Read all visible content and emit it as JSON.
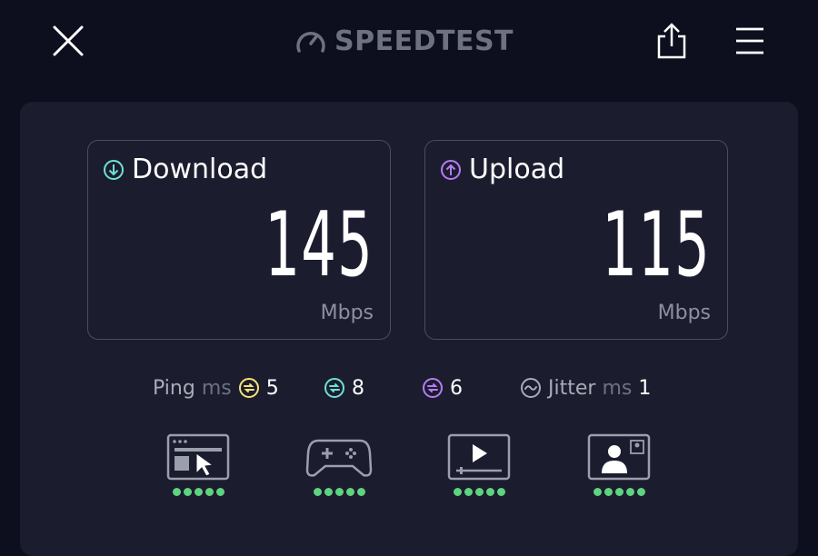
{
  "header": {
    "logo_text": "SPEEDTEST",
    "logo_mark": "®"
  },
  "download": {
    "label": "Download",
    "value": "145",
    "unit": "Mbps"
  },
  "upload": {
    "label": "Upload",
    "value": "115",
    "unit": "Mbps"
  },
  "ping": {
    "label": "Ping",
    "unit": "ms",
    "idle": "5",
    "download": "8",
    "upload": "6"
  },
  "jitter": {
    "label": "Jitter",
    "unit": "ms",
    "value": "1"
  },
  "experience": [
    {
      "icon": "web-browsing-icon",
      "rating": 5,
      "of": 5
    },
    {
      "icon": "gaming-icon",
      "rating": 5,
      "of": 5
    },
    {
      "icon": "video-streaming-icon",
      "rating": 5,
      "of": 5
    },
    {
      "icon": "video-call-icon",
      "rating": 5,
      "of": 5
    }
  ],
  "colors": {
    "background": "#0d0f1e",
    "panel": "#1b1d2e",
    "download_accent": "#6fe0d5",
    "upload_accent": "#b77bf2",
    "ping_idle": "#f6e27a",
    "rating_green": "#5fd37f"
  }
}
